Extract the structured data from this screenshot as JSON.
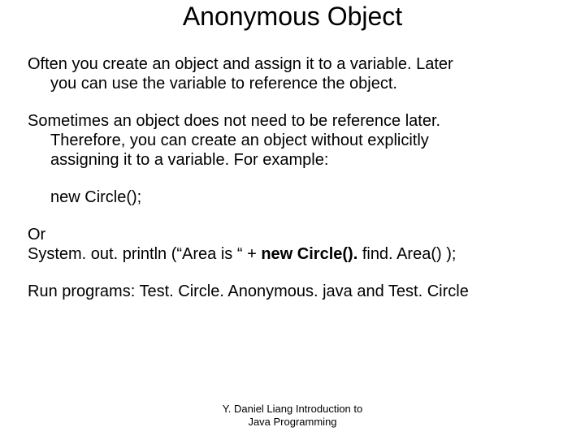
{
  "title": "Anonymous Object",
  "p1_a": "Often you create an object and assign it to a variable. Later",
  "p1_b": "you can use the variable to reference the object.",
  "p2_a": "Sometimes an object does not need to be reference later.",
  "p2_b": "Therefore, you can create an object without explicitly",
  "p2_c": "assigning it to a variable. For example:",
  "code1": "new Circle();",
  "or_label": "Or",
  "sys_pre": "System. out. println (“Area is  “ + ",
  "sys_bold": "new Circle(). ",
  "sys_post": "find. Area() );",
  "run": "Run programs: Test. Circle. Anonymous. java and Test. Circle",
  "footer1": "Y. Daniel Liang Introduction to",
  "footer2": "Java Programming"
}
